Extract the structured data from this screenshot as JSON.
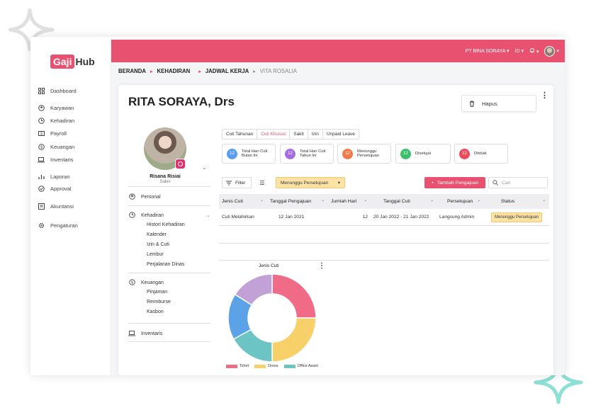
{
  "logo": {
    "part1": "Gaji",
    "part2": "Hub"
  },
  "sidebar": {
    "items": [
      {
        "label": "Dashboard",
        "icon": "dashboard-icon"
      },
      {
        "label": "Karyawan",
        "icon": "people-icon"
      },
      {
        "label": "Kehadiran",
        "icon": "clock-icon"
      },
      {
        "label": "Payroll",
        "icon": "payroll-icon"
      },
      {
        "label": "Keuangan",
        "icon": "dollar-icon"
      },
      {
        "label": "Inventaris",
        "icon": "laptop-icon"
      },
      {
        "label": "Laporan",
        "icon": "bar-chart-icon"
      },
      {
        "label": "Approval",
        "icon": "check-circle-icon"
      },
      {
        "label": "Akuntansi",
        "icon": "ledger-icon"
      },
      {
        "label": "Pengaturan",
        "icon": "gear-icon"
      }
    ]
  },
  "topbar": {
    "company": "PT BINA SORAYA",
    "language": "ID",
    "notif_icon": "bell-icon"
  },
  "breadcrumb": {
    "item1": "BERANDA",
    "item2": "KEHADIRAN",
    "item3": "JADWAL KERJA",
    "item4": "VITA ROSALIA"
  },
  "employee": {
    "name": "RITA SORAYA, Drs",
    "profile_name": "Risana Risiai",
    "profile_role": "Sales"
  },
  "actions": {
    "delete_label": "Hapus"
  },
  "profile_menu": {
    "personal": "Personal",
    "kehadiran": "Kehadiran",
    "kehadiran_sub": [
      "Histori Kehadiran",
      "Kalender",
      "Izin & Cuti",
      "Lembur",
      "Perjalanan Dinas"
    ],
    "keuangan": "Keuangan",
    "keuangan_sub": [
      "Pinjaman",
      "Reimburse",
      "Kasbon"
    ],
    "inventaris": "Inventaris"
  },
  "tabs": [
    "Cuti Tahunan",
    "Cuti Khusus",
    "Sakit",
    "Izin",
    "Unpaid Leave"
  ],
  "active_tab": "Cuti Khusus",
  "stats": [
    {
      "value": "12",
      "label": "Total Hari Cuti Bulan Ini",
      "color": "#5b9bf0"
    },
    {
      "value": "12",
      "label": "Total Hari Cuti Tahun Ini",
      "color": "#a46ee0"
    },
    {
      "value": "12",
      "label": "Menunggu Persetujuan",
      "color": "#f07a4a"
    },
    {
      "value": "12",
      "label": "Disetujui",
      "color": "#3cbf6a"
    },
    {
      "value": "12",
      "label": "Ditolak",
      "color": "#ec4b5b"
    }
  ],
  "toolbar": {
    "filter_label": "Filter",
    "status_filter": "Menunggu Persetujuan",
    "add_label": "Tambah Pengajuan",
    "search_placeholder": "Cari"
  },
  "table": {
    "headers": [
      "Jenis Cuti",
      "Tanggal Pengajuan",
      "Jumlah Hari",
      "Tanggal Cuti",
      "Persetujuan",
      "Status"
    ],
    "rows": [
      [
        "Cuti Melahirkan",
        "12 Jan 2021",
        "12",
        "20 Jan 2022 - 21 Jan 2022",
        "Langsung Admin",
        "Menunggu Persetujuan"
      ]
    ]
  },
  "chart_data": {
    "type": "pie",
    "title": "Jenis Cuti",
    "series": [
      {
        "name": "Tshirt",
        "value": 25,
        "color": "#ef6b86"
      },
      {
        "name": "Dress",
        "value": 25,
        "color": "#f7d06a"
      },
      {
        "name": "Office Asset",
        "value": 17,
        "color": "#6cc4c4"
      },
      {
        "name": "",
        "value": 17,
        "color": "#5ba2e6"
      },
      {
        "name": "",
        "value": 16,
        "color": "#c2a2d6"
      }
    ]
  },
  "colors": {
    "accent": "#e8516f",
    "warning_bg": "#ffe3a6"
  }
}
